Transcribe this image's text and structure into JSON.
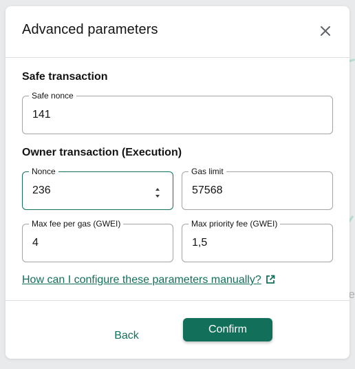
{
  "colors": {
    "accent": "#12705a",
    "text": "#121312",
    "border": "#a1a3a7"
  },
  "modal": {
    "title": "Advanced parameters",
    "close_icon": "close-icon"
  },
  "safe_section": {
    "title": "Safe transaction",
    "nonce": {
      "label": "Safe nonce",
      "value": "141"
    }
  },
  "owner_section": {
    "title": "Owner transaction (Execution)",
    "nonce": {
      "label": "Nonce",
      "value": "236"
    },
    "gas_limit": {
      "label": "Gas limit",
      "value": "57568"
    },
    "max_fee": {
      "label": "Max fee per gas (GWEI)",
      "value": "4"
    },
    "max_priority_fee": {
      "label": "Max priority fee (GWEI)",
      "value": "1,5"
    }
  },
  "help_link": {
    "text": "How can I configure these parameters manually?",
    "icon": "external-link-icon"
  },
  "footer": {
    "back_label": "Back",
    "confirm_label": "Confirm"
  }
}
